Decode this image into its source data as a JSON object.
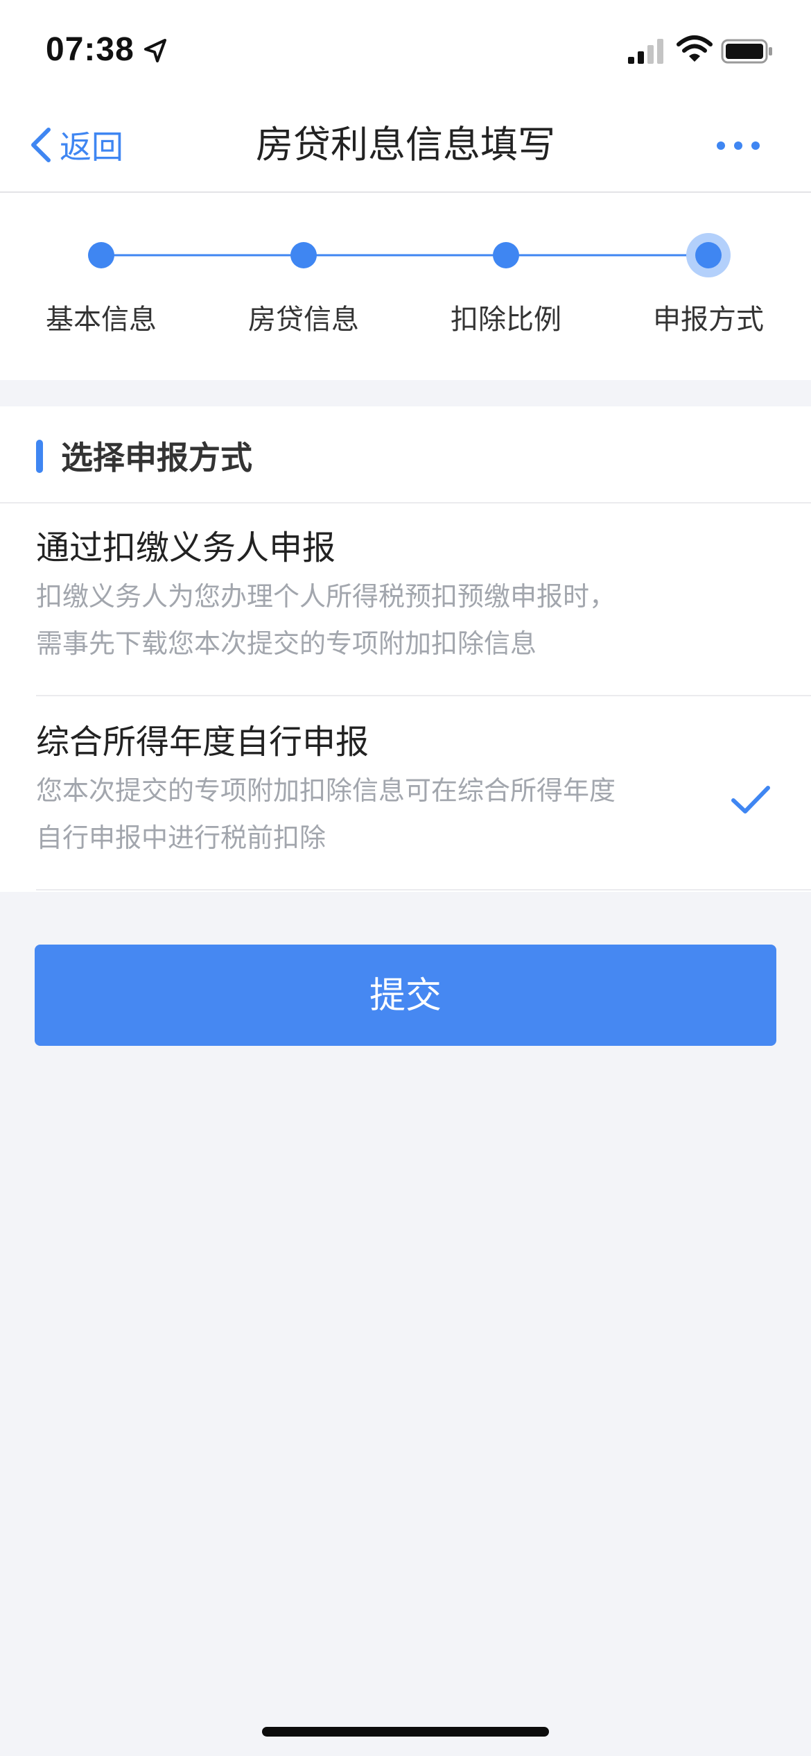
{
  "status_bar": {
    "time": "07:38",
    "icons": [
      "location-arrow-icon",
      "cellular-signal-icon",
      "wifi-icon",
      "battery-icon"
    ]
  },
  "nav": {
    "back_label": "返回",
    "title": "房贷利息信息填写",
    "more_icon": "more-dots-icon"
  },
  "stepper": {
    "steps": [
      {
        "label": "基本信息"
      },
      {
        "label": "房贷信息"
      },
      {
        "label": "扣除比例"
      },
      {
        "label": "申报方式"
      }
    ],
    "current_step": 4
  },
  "section": {
    "title": "选择申报方式",
    "options": [
      {
        "title": "通过扣缴义务人申报",
        "desc_line1": "扣缴义务人为您办理个人所得税预扣预缴申报时，",
        "desc_line2": "需事先下载您本次提交的专项附加扣除信息",
        "selected": false
      },
      {
        "title": "综合所得年度自行申报",
        "desc_line1": "您本次提交的专项附加扣除信息可在综合所得年度",
        "desc_line2": "自行申报中进行税前扣除",
        "selected": true
      }
    ]
  },
  "submit_label": "提交",
  "colors": {
    "accent": "#3f86f2",
    "button": "#4688f2",
    "background": "#f3f4f8",
    "desc_text": "#a2a6ad"
  }
}
